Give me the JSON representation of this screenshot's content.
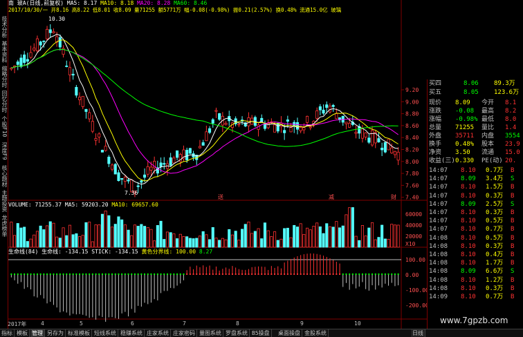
{
  "header": {
    "stock_name": "南 玻A(日线,前复权)",
    "ma5": "MA5: 8.17",
    "ma10": "MA10: 8.18",
    "ma20": "MA20: 8.28",
    "ma60": "MA60: 8.46",
    "ohlc": "2017/10/30/一 开8.16 高8.22 低8.01 收8.09 量71255 额5771万 幅-0.08(-0.98%) 振0.21(2.57%) 换0.48% 流通15.0亿 玻璃"
  },
  "left_tabs": [
    "技术分析",
    "基本资料",
    "缩略分时",
    "回忆分时",
    "个股F10",
    "深度F9",
    "核心题材",
    "主题投资",
    "龙虎榜单"
  ],
  "price_axis": [
    "9.20",
    "9.00",
    "8.80",
    "8.60",
    "8.40",
    "8.20",
    "8.00",
    "7.80",
    "7.60",
    "7.40"
  ],
  "price_annotations": {
    "high": "10.30",
    "low": "7.36"
  },
  "event_markers": [
    "送",
    "减",
    "财"
  ],
  "volume": {
    "label": "VOLUME: 71255.37",
    "ma5": "MA5: 59203.20",
    "ma10": "MA10: 69657.60",
    "axis": [
      "60000",
      "40000",
      "20000"
    ],
    "unit": "X10"
  },
  "indicator": {
    "label": "生命线(84) 生命线: -134.15",
    "stick": "STICK: -134.15",
    "yellow": "黄色分界线: 100.00",
    "value": "8.27",
    "axis": [
      "100.00",
      "0.00",
      "-100.00",
      "-200.00"
    ]
  },
  "date_axis": [
    "2017年",
    "4",
    "5",
    "6",
    "7",
    "8",
    "9",
    "10"
  ],
  "quote": {
    "rows": [
      {
        "label": "买四",
        "price": "8.06",
        "vol": "89.3万"
      },
      {
        "label": "买五",
        "price": "8.05",
        "vol": "123.6万"
      }
    ],
    "stats": [
      {
        "l1": "现价",
        "v1": "8.09",
        "l2": "今开",
        "v2": "8.1"
      },
      {
        "l1": "涨跌",
        "v1": "-0.08",
        "l2": "最高",
        "v2": "8.2"
      },
      {
        "l1": "涨幅",
        "v1": "-0.98%",
        "l2": "最低",
        "v2": "8.0"
      },
      {
        "l1": "总量",
        "v1": "71255",
        "l2": "量比",
        "v2": "1.4"
      },
      {
        "l1": "外盘",
        "v1": "35711",
        "l2": "内盘",
        "v2": "3554"
      },
      {
        "l1": "换手",
        "v1": "0.48%",
        "l2": "股本",
        "v2": "23.9"
      },
      {
        "l1": "净资",
        "v1": "3.50",
        "l2": "流通",
        "v2": "15.0"
      },
      {
        "l1": "收益(三)",
        "v1": "0.330",
        "l2": "PE(动)",
        "v2": "20."
      }
    ],
    "ticks": [
      {
        "t": "14:07",
        "p": "8.10",
        "v": "0.7万",
        "s": "B"
      },
      {
        "t": "14:07",
        "p": "8.09",
        "v": "3.4万",
        "s": "S"
      },
      {
        "t": "14:07",
        "p": "8.10",
        "v": "1.5万",
        "s": "B"
      },
      {
        "t": "14:07",
        "p": "8.10",
        "v": "0.3万",
        "s": "B"
      },
      {
        "t": "14:07",
        "p": "8.09",
        "v": "2.5万",
        "s": "S"
      },
      {
        "t": "14:07",
        "p": "8.10",
        "v": "0.3万",
        "s": "B"
      },
      {
        "t": "14:07",
        "p": "8.10",
        "v": "0.5万",
        "s": "B"
      },
      {
        "t": "14:07",
        "p": "8.10",
        "v": "0.7万",
        "s": "B"
      },
      {
        "t": "14:08",
        "p": "8.10",
        "v": "0.5万",
        "s": "B"
      },
      {
        "t": "14:08",
        "p": "8.10",
        "v": "0.3万",
        "s": "B"
      },
      {
        "t": "14:08",
        "p": "8.10",
        "v": "0.4万",
        "s": "B"
      },
      {
        "t": "14:08",
        "p": "8.10",
        "v": "1.7万",
        "s": "B"
      },
      {
        "t": "14:08",
        "p": "8.09",
        "v": "6.6万",
        "s": "S"
      },
      {
        "t": "14:08",
        "p": "8.10",
        "v": "1.2万",
        "s": "B"
      },
      {
        "t": "14:08",
        "p": "8.10",
        "v": "0.3万",
        "s": "B"
      },
      {
        "t": "14:09",
        "p": "8.10",
        "v": "0.7万",
        "s": "B"
      }
    ]
  },
  "bottom_tabs": [
    "指标",
    "模板",
    "管理",
    "另存为",
    "标准模板",
    "短线系统",
    "稳赚系统",
    "庄家系统",
    "庄家密码",
    "量图系统",
    "罗盘系统",
    "B5操盘",
    "桌面操盘",
    "金股系统"
  ],
  "right_tab": "日线",
  "watermark": "www.7gpzb.com",
  "colors": {
    "up": "#ff3232",
    "down": "#54ffff",
    "ma5": "#ffffff",
    "ma10": "#ffff00",
    "ma20": "#ff00ff",
    "ma60": "#00ff00",
    "grid": "#800000"
  }
}
